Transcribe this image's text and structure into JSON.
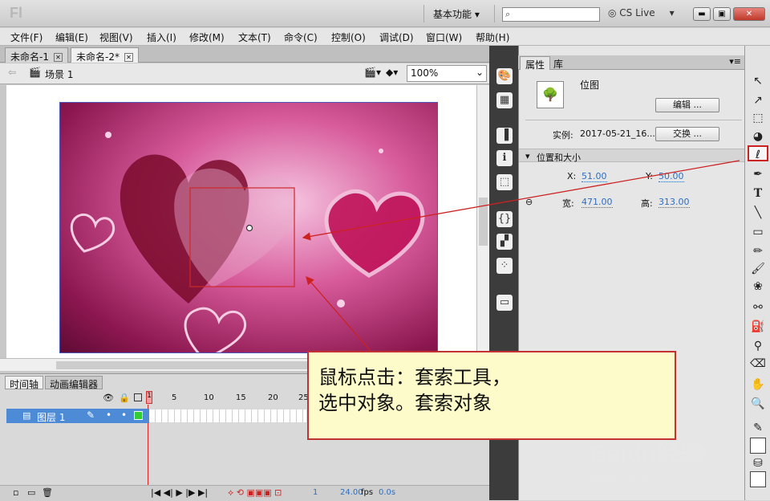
{
  "app": {
    "logo": "Fl",
    "workspace": "基本功能 ▾",
    "cslive": "CS Live"
  },
  "menu": [
    "文件(F)",
    "编辑(E)",
    "视图(V)",
    "插入(I)",
    "修改(M)",
    "文本(T)",
    "命令(C)",
    "控制(O)",
    "调试(D)",
    "窗口(W)",
    "帮助(H)"
  ],
  "doc_tabs": [
    "未命名-1",
    "未命名-2*"
  ],
  "editbar": {
    "scene": "场景 1",
    "zoom": "100%"
  },
  "timeline": {
    "tabs": [
      "时间轴",
      "动画编辑器"
    ],
    "layer": "图层 1",
    "ruler": [
      "1",
      "5",
      "10",
      "15",
      "20",
      "25"
    ],
    "fps": "24.00",
    "fps_unit": "fps",
    "time": "0.0s",
    "frame": "1"
  },
  "props": {
    "tabs": [
      "属性",
      "库"
    ],
    "type": "位图",
    "edit": "编辑 ...",
    "instance_label": "实例:",
    "instance": "2017-05-21_16...",
    "swap": "交换 ...",
    "section": "位置和大小",
    "x_label": "X:",
    "x": "51.00",
    "y_label": "Y:",
    "y": "50.00",
    "w_label": "宽:",
    "w": "471.00",
    "h_label": "高:",
    "h": "313.00"
  },
  "callout": {
    "line1": "鼠标点击：套索工具，",
    "line2": "选中对象。套索对象"
  },
  "watermark": {
    "brand": "Baidu经验",
    "url": "jingyan.baidu.com"
  }
}
